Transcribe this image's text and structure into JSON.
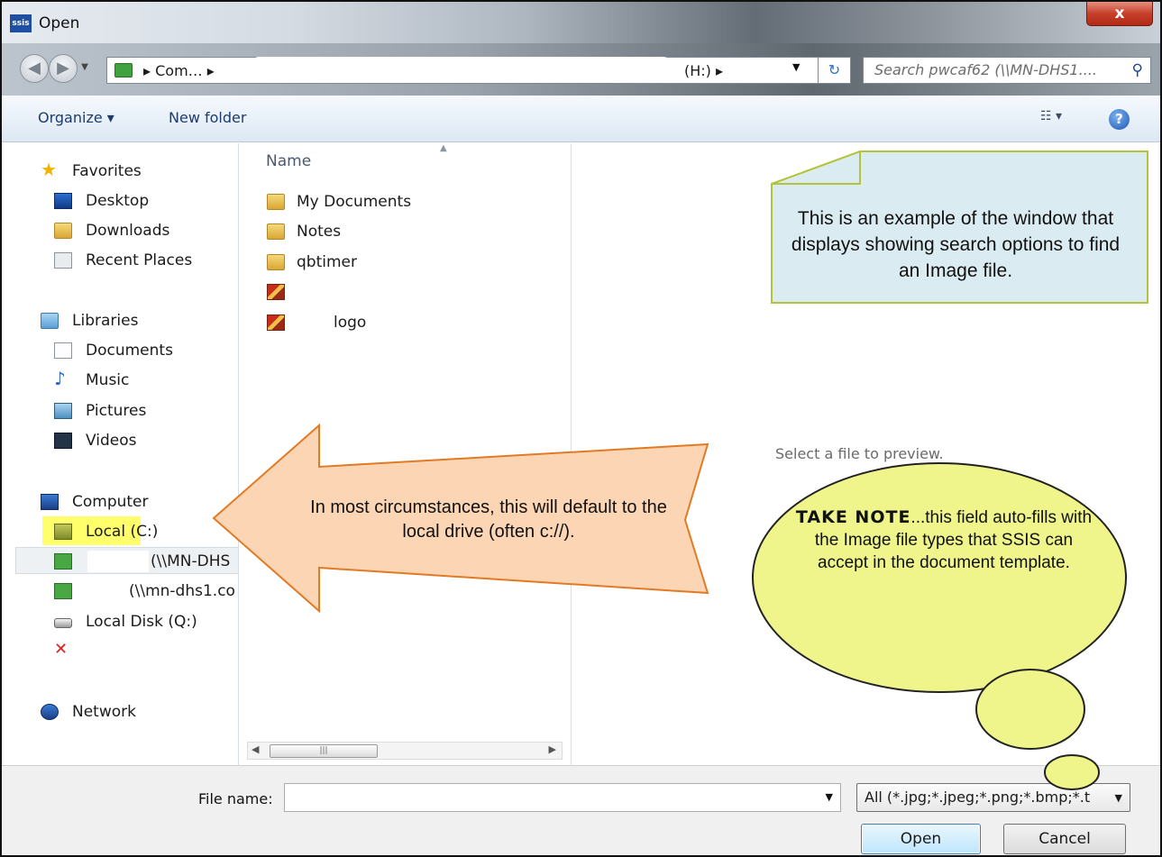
{
  "window": {
    "title": "Open",
    "app_icon_text": "ssis",
    "close_label": "x"
  },
  "address": {
    "crumb_start": "▸ Com… ▸",
    "crumb_drive": "(H:) ▸",
    "search_placeholder": "Search pwcaf62 (\\\\MN-DHS1....",
    "back_icon": "back-arrow-icon",
    "forward_icon": "forward-arrow-icon"
  },
  "toolbar": {
    "organize_label": "Organize ▾",
    "new_folder_label": "New folder",
    "view_label": "☷ ▾",
    "help_label": "?"
  },
  "nav": {
    "favorites": "Favorites",
    "desktop": "Desktop",
    "downloads": "Downloads",
    "recent_places": "Recent Places",
    "libraries": "Libraries",
    "documents": "Documents",
    "music": "Music",
    "pictures": "Pictures",
    "videos": "Videos",
    "computer": "Computer",
    "local_c": "Local (C:)",
    "mapped1": "(\\\\MN-DHS",
    "mapped2": "(\\\\mn-dhs1.co",
    "local_q": "Local Disk (Q:)",
    "network": "Network"
  },
  "files": {
    "column_name": "Name",
    "items": [
      "My Documents",
      "Notes",
      "qbtimer",
      "",
      "logo"
    ]
  },
  "preview": {
    "text": "Select a file to preview."
  },
  "bottom": {
    "file_name_label": "File name:",
    "file_name_value": "",
    "file_type": "All (*.jpg;*.jpeg;*.png;*.bmp;*.t",
    "open_label": "Open",
    "cancel_label": "Cancel"
  },
  "annotations": {
    "note": "This is an example of the window that displays showing search options to find an Image file.",
    "arrow": "In most circumstances, this will default to the local drive (often c://).",
    "bubble_bold": "TAKE NOTE",
    "bubble_rest": "...this field auto-fills with the Image file types that SSIS can accept in the document template."
  },
  "colors": {
    "note_fill": "#dbebf2",
    "note_border": "#b3c43a",
    "arrow_fill": "#fcd5b4",
    "arrow_border": "#e27a24",
    "bubble_fill": "#eff58a",
    "bubble_border": "#222222",
    "highlight": "#ffff6b"
  }
}
